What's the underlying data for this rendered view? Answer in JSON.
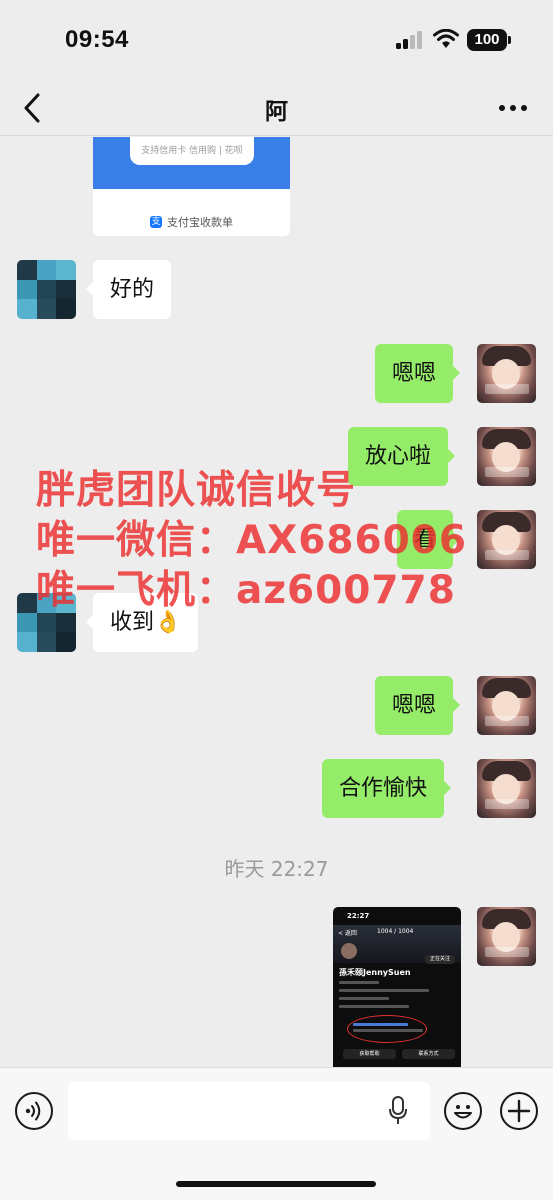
{
  "status_bar": {
    "time": "09:54",
    "battery": "100"
  },
  "nav": {
    "title": "阿",
    "back_icon": "chevron-left-icon",
    "more_icon": "more-dots-icon"
  },
  "payment_card": {
    "subtitle": "支持信用卡 信用购 | 花呗",
    "footer": "支付宝收款单",
    "footer_icon": "alipay-icon"
  },
  "messages": [
    {
      "side": "left",
      "text": "好的"
    },
    {
      "side": "right",
      "text": "嗯嗯"
    },
    {
      "side": "right",
      "text": "放心啦"
    },
    {
      "side": "right",
      "text": "看"
    },
    {
      "side": "left",
      "text": "收到👌"
    },
    {
      "side": "right",
      "text": "嗯嗯"
    },
    {
      "side": "right",
      "text": "合作愉快"
    }
  ],
  "timestamp": "昨天 22:27",
  "screenshot_message": {
    "time": "22:27",
    "back": "< 返回",
    "count": "1004 / 1004",
    "follow_btn": "正在关注",
    "name": "孫禾颐JennySuen",
    "tabs": [
      "获取帮助",
      "联系方式"
    ]
  },
  "watermark": {
    "line1": "胖虎团队诚信收号",
    "line2": "唯一微信：AX686006",
    "line3": "唯一飞机：az600778"
  },
  "input_bar": {
    "voice_icon": "voice-icon",
    "mic_icon": "mic-icon",
    "emoji_icon": "emoji-icon",
    "plus_icon": "plus-icon"
  },
  "colors": {
    "sent_bubble": "#95ec69",
    "received_bubble": "#ffffff",
    "background": "#ededed",
    "watermark": "#eb2d2d"
  }
}
